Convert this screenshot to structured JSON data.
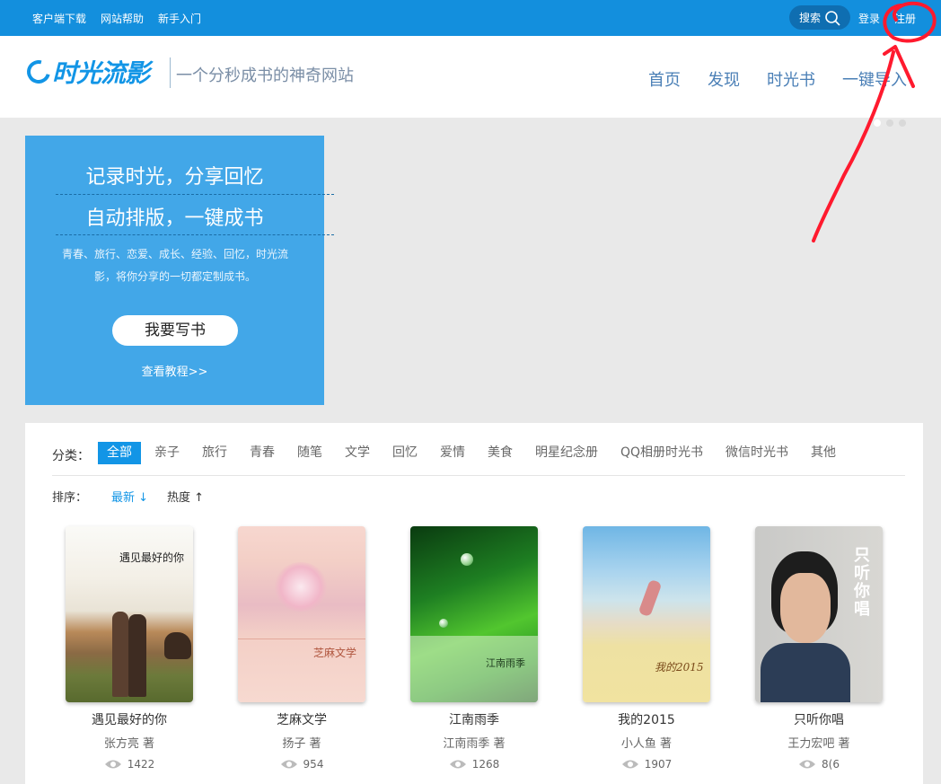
{
  "topbar": {
    "links": [
      "客户端下载",
      "网站帮助",
      "新手入门"
    ],
    "search_label": "搜索",
    "login_label": "登录",
    "register_label": "注册"
  },
  "header": {
    "logo_text": "时光流影",
    "slogan": "一个分秒成书的神奇网站",
    "nav": [
      "首页",
      "发现",
      "时光书",
      "一键导入"
    ]
  },
  "promo": {
    "line1": "记录时光，分享回忆",
    "line2": "自动排版，一键成书",
    "desc1": "青春、旅行、恋爱、成长、经验、回忆，时光流",
    "desc2": "影，将你分享的一切都定制成书。",
    "write_button": "我要写书",
    "tutorial_link": "查看教程>>"
  },
  "filters": {
    "category_label": "分类：",
    "categories": [
      "全部",
      "亲子",
      "旅行",
      "青春",
      "随笔",
      "文学",
      "回忆",
      "爱情",
      "美食",
      "明星纪念册",
      "QQ相册时光书",
      "微信时光书",
      "其他"
    ],
    "sort_label": "排序：",
    "sort_options": [
      "最新",
      "热度"
    ]
  },
  "books": [
    {
      "title": "遇见最好的你",
      "author": "张方亮 著",
      "views": "1422",
      "cover_text": "遇见最好的你"
    },
    {
      "title": "芝麻文学",
      "author": "扬子 著",
      "views": "954",
      "cover_text": "芝麻文学"
    },
    {
      "title": "江南雨季",
      "author": "江南雨季 著",
      "views": "1268",
      "cover_text": "江南雨季"
    },
    {
      "title": "我的2015",
      "author": "小人鱼 著",
      "views": "1907",
      "cover_text": "我的2015"
    },
    {
      "title": "只听你唱",
      "author": "王力宏吧 著",
      "views": "8(6",
      "cover_text": "只听你唱"
    }
  ],
  "colors": {
    "primary": "#138fdd",
    "promo": "#42a7e8",
    "annotation": "#ff1a2e"
  }
}
